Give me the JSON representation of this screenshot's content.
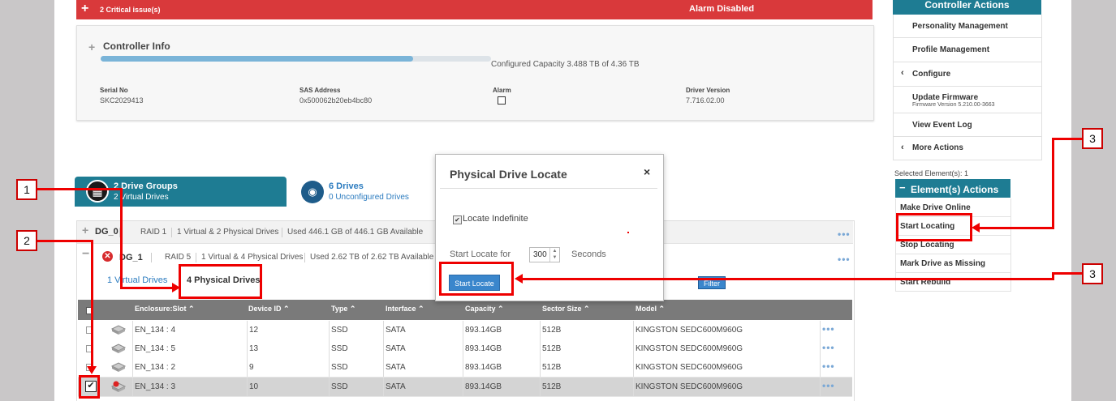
{
  "alarm_bar": {
    "plus": "+",
    "critical": "2 Critical issue(s)",
    "alarm_status": "Alarm Disabled"
  },
  "controller_info": {
    "toggle": "+",
    "title": "Controller Info",
    "capacity_text": "Configured Capacity 3.488 TB of 4.36 TB",
    "capacity_fraction": 0.8,
    "fields": [
      {
        "label": "Serial No",
        "value": "SKC2029413"
      },
      {
        "label": "SAS Address",
        "value": "0x500062b20eb4bc80"
      },
      {
        "label": "Alarm",
        "value": ""
      },
      {
        "label": "Driver Version",
        "value": "7.716.02.00"
      }
    ]
  },
  "tabs": [
    {
      "title": "2 Drive Groups",
      "subtitle": "2 Virtual Drives",
      "icon": "chip-icon"
    },
    {
      "title": "6 Drives",
      "subtitle": "0 Unconfigured Drives",
      "icon": "drive-icon"
    }
  ],
  "drive_groups": [
    {
      "toggle": "+",
      "name": "DG_0",
      "raid": "RAID 1",
      "summary": "1 Virtual & 2 Physical Drives",
      "usage": "Used 446.1 GB of 446.1 GB Available",
      "more": "•••"
    },
    {
      "toggle": "−",
      "name": "DG_1",
      "raid": "RAID 5",
      "summary": "1 Virtual & 4 Physical Drives",
      "usage": "Used 2.62 TB of 2.62 TB Available",
      "more": "•••"
    }
  ],
  "subtabs": {
    "virtual": "1 Virtual Drives",
    "physical": "4 Physical Drives",
    "filter": "Filter"
  },
  "table": {
    "columns": [
      "Enclosure:Slot ⌃",
      "Device ID ⌃",
      "Type ⌃",
      "Interface ⌃",
      "Capacity ⌃",
      "Sector Size ⌃",
      "Model ⌃"
    ],
    "rows": [
      {
        "slot": "EN_134 : 4",
        "device_id": "12",
        "type": "SSD",
        "interface": "SATA",
        "capacity": "893.14GB",
        "sector": "512B",
        "model": "KINGSTON SEDC600M960G",
        "more": "•••"
      },
      {
        "slot": "EN_134 : 5",
        "device_id": "13",
        "type": "SSD",
        "interface": "SATA",
        "capacity": "893.14GB",
        "sector": "512B",
        "model": "KINGSTON SEDC600M960G",
        "more": "•••"
      },
      {
        "slot": "EN_134 : 2",
        "device_id": "9",
        "type": "SSD",
        "interface": "SATA",
        "capacity": "893.14GB",
        "sector": "512B",
        "model": "KINGSTON SEDC600M960G",
        "more": "•••"
      },
      {
        "slot": "EN_134 : 3",
        "device_id": "10",
        "type": "SSD",
        "interface": "SATA",
        "capacity": "893.14GB",
        "sector": "512B",
        "model": "KINGSTON SEDC600M960G",
        "more": "•••",
        "selected": true
      }
    ]
  },
  "modal": {
    "title": "Physical Drive Locate",
    "close": "×",
    "checkbox_label": "Locate Indefinite",
    "locate_for_label": "Start Locate for",
    "seconds_value": "300",
    "seconds_label": "Seconds",
    "start_button": "Start Locate"
  },
  "controller_actions": {
    "header": "Controller Actions",
    "items": [
      {
        "label": "Personality Management",
        "chevron": ""
      },
      {
        "label": "Profile Management",
        "chevron": ""
      },
      {
        "label": "Configure",
        "chevron": "‹"
      },
      {
        "label": "Update Firmware",
        "sub": "Firmware Version 5.210.00-3663",
        "chevron": ""
      },
      {
        "label": "View Event Log",
        "chevron": ""
      },
      {
        "label": "More Actions",
        "chevron": "‹"
      }
    ]
  },
  "selected_elements": "Selected Element(s): 1",
  "element_actions": {
    "toggle": "−",
    "header": "Element(s) Actions",
    "items": [
      "Make Drive Online",
      "Start Locating",
      "Stop Locating",
      "Mark Drive as Missing",
      "Start Rebuild"
    ]
  },
  "callouts": [
    "1",
    "2",
    "3",
    "3"
  ],
  "colors": {
    "accent": "#1e7c93",
    "alarm": "#d9393b",
    "callout": "#e00000",
    "button": "#3a86cc"
  }
}
